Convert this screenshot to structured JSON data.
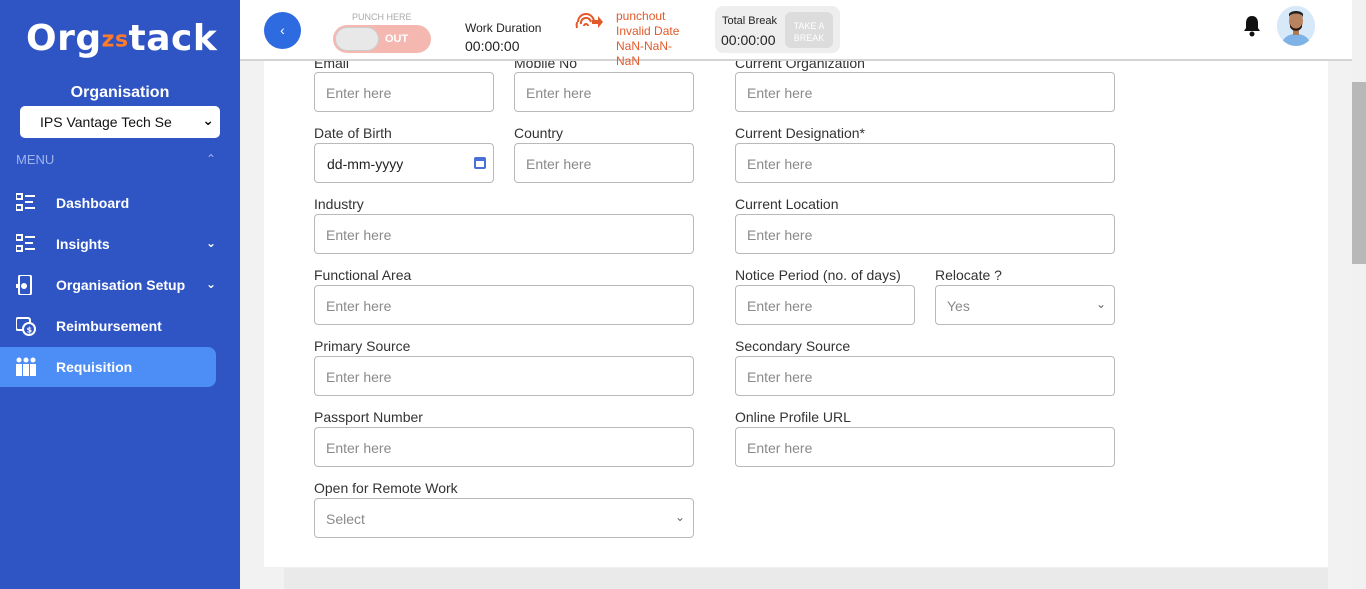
{
  "sidebar": {
    "logo": {
      "part1": "Org",
      "part2": "zs",
      "part3": "tack"
    },
    "org_label": "Organisation",
    "org_select_value": "IPS Vantage Tech Se",
    "menu_heading": "MENU",
    "items": [
      {
        "label": "Dashboard",
        "icon": "dashboard-list-icon",
        "has_caret": false,
        "active": false
      },
      {
        "label": "Insights",
        "icon": "insights-list-icon",
        "has_caret": true,
        "active": false
      },
      {
        "label": "Organisation Setup",
        "icon": "organisation-setup-icon",
        "has_caret": true,
        "active": false
      },
      {
        "label": "Reimbursement",
        "icon": "reimbursement-icon",
        "has_caret": false,
        "active": false
      },
      {
        "label": "Requisition",
        "icon": "requisition-people-icon",
        "has_caret": false,
        "active": true
      }
    ]
  },
  "topbar": {
    "punch_here": "PUNCH HERE",
    "toggle_label": "OUT",
    "work_duration_label": "Work Duration",
    "work_duration_value": "00:00:00",
    "punch_status_line1": "punchout",
    "punch_status_line2": "Invalid Date",
    "punch_status_line3": "NaN-NaN-",
    "punch_status_line4": "NaN",
    "total_break_label": "Total Break",
    "total_break_value": "00:00:00",
    "take_break_line1": "TAKE A",
    "take_break_line2": "BREAK"
  },
  "form": {
    "email_label": "Email",
    "email_placeholder": "Enter here",
    "mobile_label": "Mobile No",
    "mobile_placeholder": "Enter here",
    "current_org_label": "Current Organization",
    "current_org_placeholder": "Enter here",
    "dob_label": "Date of Birth",
    "dob_value": "dd-mm-yyyy",
    "country_label": "Country",
    "country_placeholder": "Enter here",
    "designation_label": "Current Designation*",
    "designation_placeholder": "Enter here",
    "industry_label": "Industry",
    "industry_placeholder": "Enter here",
    "location_label": "Current Location",
    "location_placeholder": "Enter here",
    "functional_label": "Functional Area",
    "functional_placeholder": "Enter here",
    "notice_label": "Notice Period (no. of days)",
    "notice_placeholder": "Enter here",
    "relocate_label": "Relocate ?",
    "relocate_value": "Yes",
    "primary_source_label": "Primary Source",
    "primary_source_placeholder": "Enter here",
    "secondary_source_label": "Secondary Source",
    "secondary_source_placeholder": "Enter here",
    "passport_label": "Passport Number",
    "passport_placeholder": "Enter here",
    "profile_url_label": "Online Profile URL",
    "profile_url_placeholder": "Enter here",
    "remote_label": "Open for Remote Work",
    "remote_value": "Select"
  },
  "colors": {
    "sidebar": "#2f55c4",
    "active_item": "#4d8df6",
    "accent_orange": "#e35a2a"
  }
}
